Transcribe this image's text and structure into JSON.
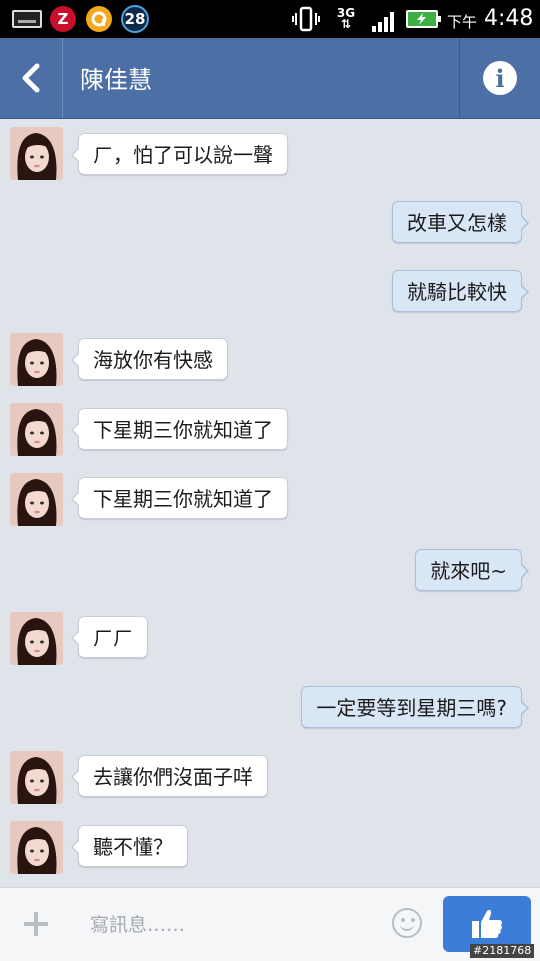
{
  "status_bar": {
    "notification_count": "28",
    "z_label": "Z",
    "network": "3G",
    "ampm": "下午",
    "time": "4:48",
    "icons": [
      "keyboard-icon",
      "z-app-icon",
      "a-app-icon",
      "counter-badge-icon",
      "vibrate-icon",
      "network-3g-icon",
      "signal-icon",
      "battery-icon"
    ]
  },
  "header": {
    "contact_name": "陳佳慧",
    "back_icon": "chevron-left-icon",
    "info_icon": "info-icon",
    "bar_color": "#4c6fa6"
  },
  "messages": [
    {
      "side": "in",
      "text": "ㄏ，怕了可以說一聲"
    },
    {
      "side": "out",
      "text": "改車又怎樣"
    },
    {
      "side": "out",
      "text": "就騎比較快"
    },
    {
      "side": "in",
      "text": "海放你有快感"
    },
    {
      "side": "in",
      "text": "下星期三你就知道了"
    },
    {
      "side": "in",
      "text": "下星期三你就知道了"
    },
    {
      "side": "out",
      "text": "就來吧~"
    },
    {
      "side": "in",
      "text": "ㄏㄏ"
    },
    {
      "side": "out",
      "text": "一定要等到星期三嗎?"
    },
    {
      "side": "in",
      "text": "去讓你們沒面子咩"
    },
    {
      "side": "in",
      "text": "聽不懂？"
    }
  ],
  "composer": {
    "placeholder": "寫訊息……",
    "value": "",
    "plus_icon": "plus-icon",
    "emoji_icon": "smiley-icon",
    "like_icon": "thumbs-up-icon",
    "like_color": "#3b7dd8"
  },
  "watermark": "#2181768"
}
